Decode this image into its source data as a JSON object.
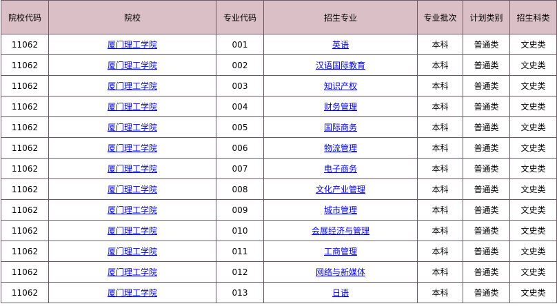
{
  "table": {
    "headers": [
      "院校代码",
      "院校",
      "专业代码",
      "招生专业",
      "专业批次",
      "计划类别",
      "招生科类"
    ],
    "rows": [
      {
        "school_code": "11062",
        "school": "厦门理工学院",
        "major_code": "001",
        "major": "英语",
        "batch": "本科",
        "plan_type": "普通类",
        "subject": "文史类"
      },
      {
        "school_code": "11062",
        "school": "厦门理工学院",
        "major_code": "002",
        "major": "汉语国际教育",
        "batch": "本科",
        "plan_type": "普通类",
        "subject": "文史类"
      },
      {
        "school_code": "11062",
        "school": "厦门理工学院",
        "major_code": "003",
        "major": "知识产权",
        "batch": "本科",
        "plan_type": "普通类",
        "subject": "文史类"
      },
      {
        "school_code": "11062",
        "school": "厦门理工学院",
        "major_code": "004",
        "major": "财务管理",
        "batch": "本科",
        "plan_type": "普通类",
        "subject": "文史类"
      },
      {
        "school_code": "11062",
        "school": "厦门理工学院",
        "major_code": "005",
        "major": "国际商务",
        "batch": "本科",
        "plan_type": "普通类",
        "subject": "文史类"
      },
      {
        "school_code": "11062",
        "school": "厦门理工学院",
        "major_code": "006",
        "major": "物流管理",
        "batch": "本科",
        "plan_type": "普通类",
        "subject": "文史类"
      },
      {
        "school_code": "11062",
        "school": "厦门理工学院",
        "major_code": "007",
        "major": "电子商务",
        "batch": "本科",
        "plan_type": "普通类",
        "subject": "文史类"
      },
      {
        "school_code": "11062",
        "school": "厦门理工学院",
        "major_code": "008",
        "major": "文化产业管理",
        "batch": "本科",
        "plan_type": "普通类",
        "subject": "文史类"
      },
      {
        "school_code": "11062",
        "school": "厦门理工学院",
        "major_code": "009",
        "major": "城市管理",
        "batch": "本科",
        "plan_type": "普通类",
        "subject": "文史类"
      },
      {
        "school_code": "11062",
        "school": "厦门理工学院",
        "major_code": "010",
        "major": "会展经济与管理",
        "batch": "本科",
        "plan_type": "普通类",
        "subject": "文史类"
      },
      {
        "school_code": "11062",
        "school": "厦门理工学院",
        "major_code": "011",
        "major": "工商管理",
        "batch": "本科",
        "plan_type": "普通类",
        "subject": "文史类"
      },
      {
        "school_code": "11062",
        "school": "厦门理工学院",
        "major_code": "012",
        "major": "网络与新媒体",
        "batch": "本科",
        "plan_type": "普通类",
        "subject": "文史类"
      },
      {
        "school_code": "11062",
        "school": "厦门理工学院",
        "major_code": "013",
        "major": "日语",
        "batch": "本科",
        "plan_type": "普通类",
        "subject": "文史类"
      }
    ]
  }
}
